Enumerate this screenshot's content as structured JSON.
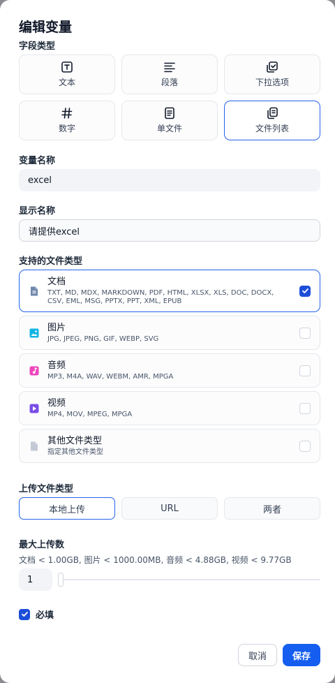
{
  "dialog": {
    "title": "编辑变量",
    "field_type_label": "字段类型",
    "field_types": [
      {
        "label": "文本",
        "icon": "text-box-icon"
      },
      {
        "label": "段落",
        "icon": "paragraph-icon"
      },
      {
        "label": "下拉选项",
        "icon": "select-icon"
      },
      {
        "label": "数字",
        "icon": "hash-icon"
      },
      {
        "label": "单文件",
        "icon": "single-file-icon"
      },
      {
        "label": "文件列表",
        "icon": "file-list-icon",
        "selected": true
      }
    ],
    "variable_name_label": "变量名称",
    "variable_name_value": "excel",
    "display_name_label": "显示名称",
    "display_name_value": "请提供excel",
    "file_types_label": "支持的文件类型",
    "file_types": [
      {
        "name": "文档",
        "desc": "TXT, MD, MDX, MARKDOWN, PDF, HTML, XLSX, XLS, DOC, DOCX, CSV, EML, MSG, PPTX, PPT, XML, EPUB",
        "icon": "document-icon",
        "color": "#6e87ad",
        "checked": true
      },
      {
        "name": "图片",
        "desc": "JPG, JPEG, PNG, GIF, WEBP, SVG",
        "icon": "image-icon",
        "color": "#11b5e4",
        "checked": false
      },
      {
        "name": "音频",
        "desc": "MP3, M4A, WAV, WEBM, AMR, MPGA",
        "icon": "audio-icon",
        "color": "#ee46bc",
        "checked": false
      },
      {
        "name": "视频",
        "desc": "MP4, MOV, MPEG, MPGA",
        "icon": "video-icon",
        "color": "#7a4ee8",
        "checked": false
      },
      {
        "name": "其他文件类型",
        "desc": "指定其他文件类型",
        "icon": "other-file-icon",
        "color": "#c3cad6",
        "checked": false
      }
    ],
    "upload_type_label": "上传文件类型",
    "upload_options": [
      {
        "label": "本地上传",
        "selected": true
      },
      {
        "label": "URL",
        "selected": false
      },
      {
        "label": "两者",
        "selected": false
      }
    ],
    "max_upload_label": "最大上传数",
    "max_upload_limits": "文档 < 1.00GB, 图片 < 1000.00MB, 音频 < 4.88GB, 视频 < 9.77GB",
    "max_upload_value": "1",
    "required_label": "必填",
    "required_checked": true,
    "cancel_label": "取消",
    "save_label": "保存",
    "accent_color": "#155eef"
  }
}
